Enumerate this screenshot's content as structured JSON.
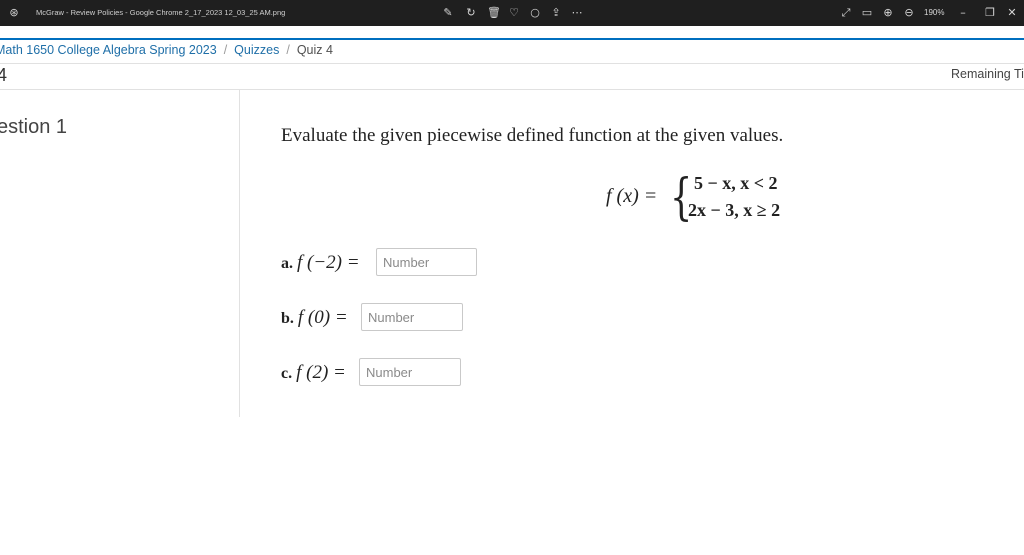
{
  "viewer": {
    "filename": "McGraw - Review Policies - Google Chrome 2_17_2023 12_03_25 AM.png",
    "zoom": "190%",
    "icons": [
      "app-icon",
      "edit-icon",
      "rotate-icon",
      "delete-icon",
      "favorite-icon",
      "crop-icon",
      "share-icon",
      "more-icon",
      "fullscreen-icon",
      "fit-icon",
      "zoom-in-icon",
      "zoom-out-icon",
      "minimize-icon",
      "maximize-icon",
      "close-icon"
    ]
  },
  "breadcrumb": {
    "course": "Math 1650 College Algebra Spring 2023",
    "section": "Quizzes",
    "current": "Quiz 4",
    "separator": "/"
  },
  "quiz": {
    "title_fragment": "4",
    "remaining_label": "Remaining Tir",
    "question_label": "estion 1"
  },
  "question": {
    "prompt": "Evaluate the given piecewise defined function at the given values.",
    "function_lhs": "f (x) =",
    "case1": "5 − x,  x < 2",
    "case2": "2x − 3,  x ≥ 2",
    "parts": [
      {
        "label": "a.",
        "expr": "f (−2) =",
        "placeholder": "Number",
        "value": ""
      },
      {
        "label": "b.",
        "expr": "f (0) =",
        "placeholder": "Number",
        "value": ""
      },
      {
        "label": "c.",
        "expr": "f (2) =",
        "placeholder": "Number",
        "value": ""
      }
    ]
  },
  "colors": {
    "accent": "#006fbf",
    "link": "#1f6fa8",
    "titlebar": "#1f1f1f"
  }
}
